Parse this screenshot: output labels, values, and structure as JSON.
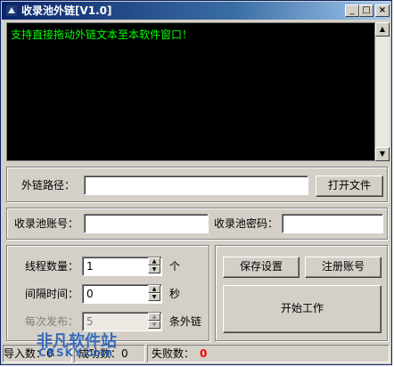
{
  "window": {
    "title": "收录池外链[V1.0]"
  },
  "titlebar_buttons": {
    "minimize": "_",
    "maximize": "□",
    "close": "×"
  },
  "console": {
    "message": "支持直接拖动外链文本至本软件窗口！"
  },
  "path_group": {
    "label": "外链路径：",
    "value": "",
    "button": "打开文件"
  },
  "account_group": {
    "account_label": "收录池账号：",
    "account_value": "",
    "password_label": "收录池密码：",
    "password_value": ""
  },
  "settings": {
    "thread_label": "线程数量：",
    "thread_value": "1",
    "thread_unit": "个",
    "interval_label": "间隔时间：",
    "interval_value": "0",
    "interval_unit": "秒",
    "batch_label": "每次发布：",
    "batch_value": "5",
    "batch_unit": "条外链"
  },
  "actions": {
    "save": "保存设置",
    "register": "注册账号",
    "start": "开始工作"
  },
  "status": {
    "imported_label": "导入数：",
    "imported_value": "0",
    "success_label": "成功数：",
    "success_value": "0",
    "fail_label": "失败数：",
    "fail_value": "0"
  },
  "watermark": {
    "text": "非凡软件站",
    "subtext": "CRSKY.com"
  },
  "colors": {
    "console_text": "#00ff00",
    "fail_value": "#ff0000",
    "title_bar": "#0a246a"
  }
}
